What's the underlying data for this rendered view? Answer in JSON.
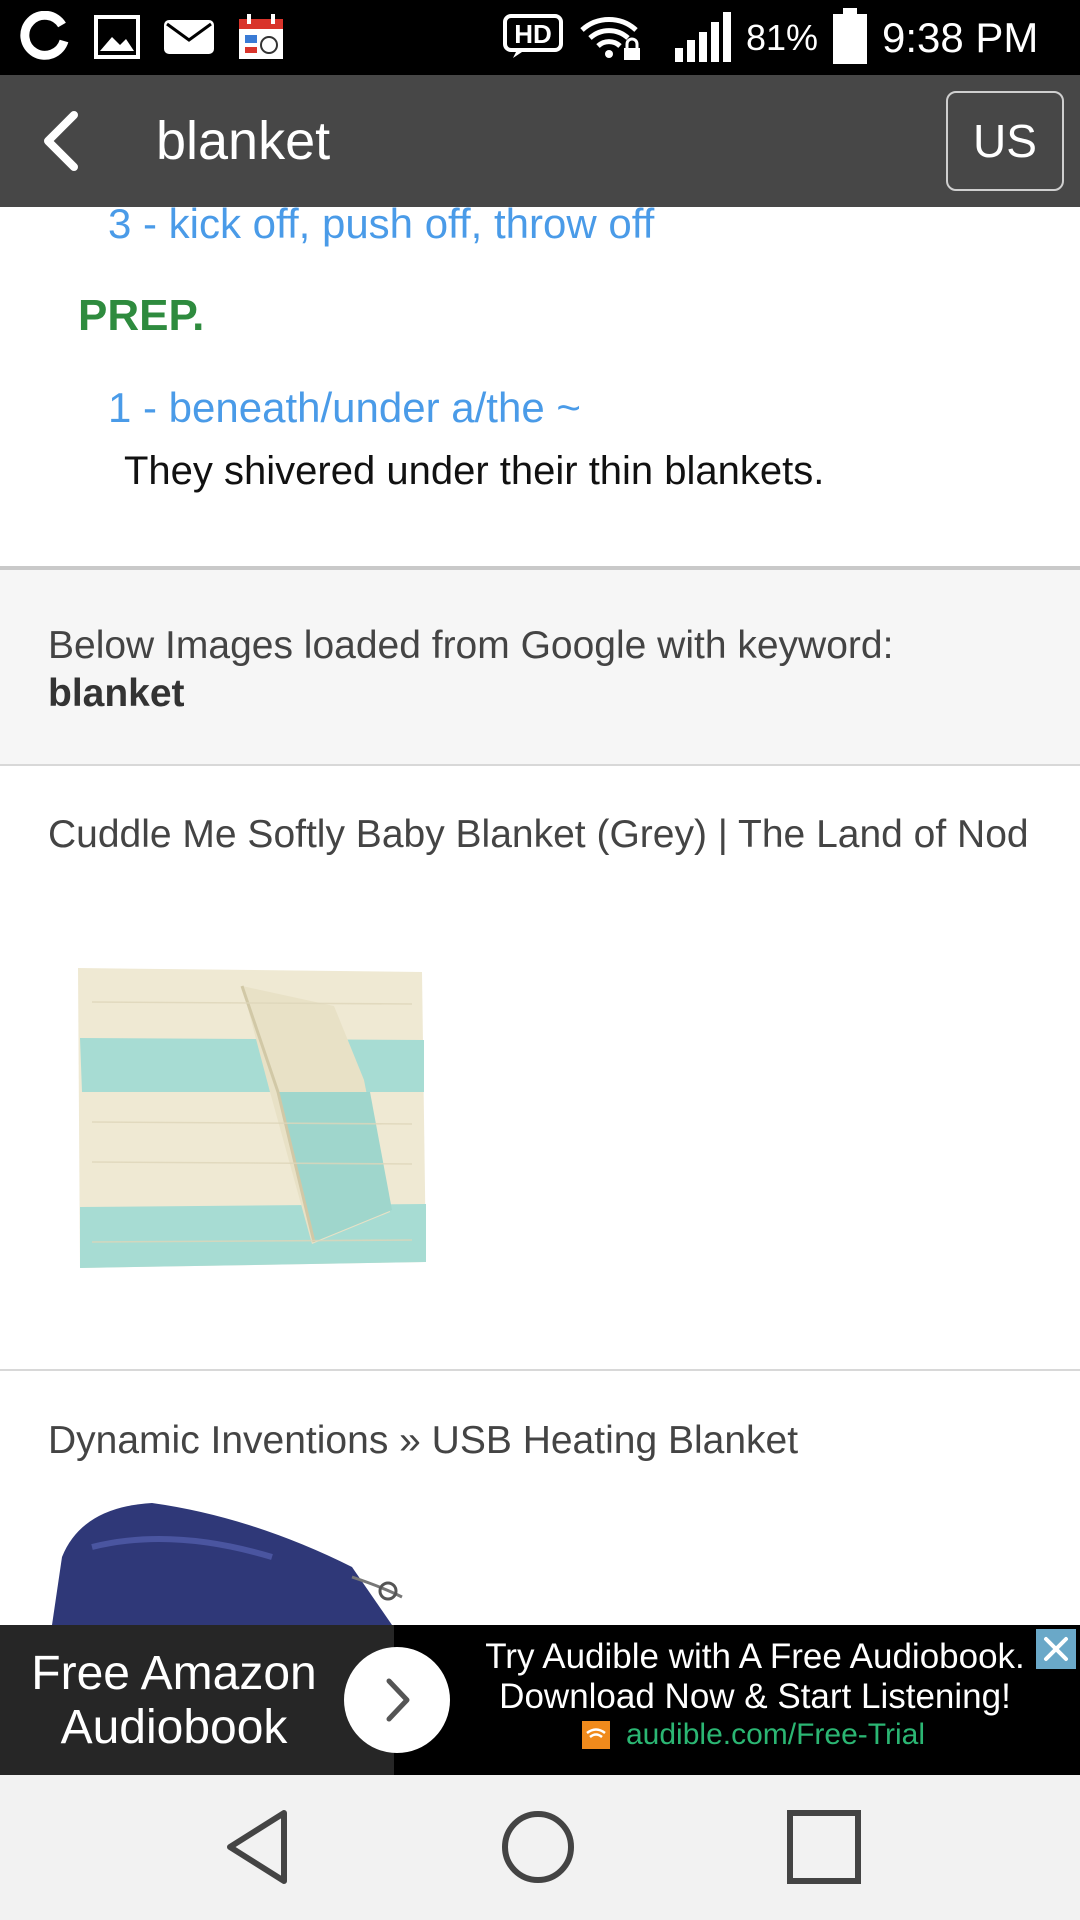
{
  "status_bar": {
    "battery_percent": "81%",
    "time": "9:38 PM",
    "hd_label": "HD",
    "icons": [
      "app-o-icon",
      "gallery-icon",
      "email-icon",
      "calendar-icon",
      "hd-icon",
      "wifi-lock-icon",
      "signal-icon",
      "battery-icon"
    ]
  },
  "app_bar": {
    "title": "blanket",
    "language_button": "US",
    "back_icon": "back-arrow-icon"
  },
  "definitions": {
    "verb_item_3": "3 - kick off, push off, throw off",
    "prep_label": "PREP.",
    "prep_item_1": "1 - beneath/under a/the ~",
    "prep_example_1": "They shivered under their thin blankets."
  },
  "google_info": {
    "text": "Below Images loaded from Google with keyword:",
    "keyword": "blanket"
  },
  "results": [
    {
      "title": "Cuddle Me Softly Baby Blanket (Grey) | The Land of Nod"
    },
    {
      "title": "Dynamic Inventions » USB Heating Blanket"
    }
  ],
  "ad": {
    "left_text": "Free Amazon Audiobook",
    "line1": "Try Audible with A Free Audiobook.",
    "line2": "Download Now & Start Listening!",
    "url": "audible.com/Free-Trial",
    "colors": {
      "url": "#2bb673",
      "icon": "#f08a1c"
    }
  },
  "nav_bar": {
    "buttons": [
      "back-triangle-icon",
      "home-circle-icon",
      "recents-square-icon"
    ]
  },
  "colors": {
    "app_bar": "#474747",
    "definition_link": "#4a9be8",
    "pos_label": "#2e8b3e"
  }
}
